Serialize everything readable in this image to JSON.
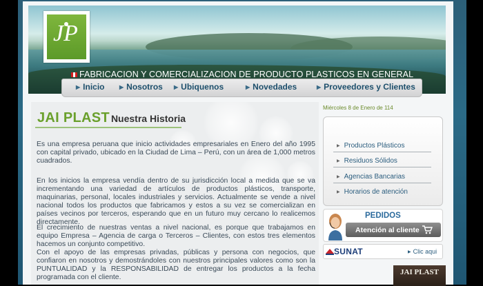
{
  "header": {
    "tagline": "FABRICACION Y COMERCIALIZACION DE PRODUCTO PLASTICOS EN GENERAL",
    "logo_text": "JP",
    "nav": [
      {
        "label": "Inicio"
      },
      {
        "label": "Nosotros"
      },
      {
        "label": "Ubiquenos"
      },
      {
        "label": "Novedades"
      },
      {
        "label": "Proveedores y Clientes"
      }
    ]
  },
  "main": {
    "brand": "JAI PLAST",
    "subtitle": "Nuestra Historia",
    "paragraphs": [
      "Es una empresa peruana que inicio  actividades  empresariales en Enero del año 1995 con capital  privado,  ubicado en la Ciudad de Lima – Perú, con un área de 1,000 metros cuadrados.",
      "En los inicios la empresa vendía dentro de su jurisdicción local a medida que se va incrementando una variedad de artículos de productos plásticos, transporte, maquinarias, personal, locales industriales y servicios. Actualmente se  vende a nivel nacional  todos los  productos que fabricamos y  estos a su vez se comercializan en países vecinos por terceros, esperando que en un  futuro muy  cercano lo realicemos directamente.",
      "El crecimiento de  nuestras ventas a nivel nacional, es porque que trabajamos en equipo Empresa – Agencia de carga o Terceros – Clientes, con estos tres elementos hacemos un conjunto competitivo.",
      "Con el apoyo de las empresas privadas, públicas y persona con negocios,  que confiaron en nosotros y  demostrándoles con  nuestros principales valores como son la PUNTUALIDAD y la RESPONSABILIDAD de entregar los productos a la fecha programada con el cliente."
    ]
  },
  "sidebar": {
    "date": "Miércoles 8 de Enero de 114",
    "links": [
      {
        "label": "Productos Plásticos"
      },
      {
        "label": "Residuos Sólidos"
      },
      {
        "label": "Agencias Bancarias"
      },
      {
        "label": "Horarios de atención"
      }
    ],
    "pedidos_title": "PEDIDOS",
    "pedidos_button": "Atención al cliente",
    "sunat_logo": "SUNAT",
    "sunat_link": "Clic aqui",
    "promo_text": "JAI PLAST"
  },
  "colors": {
    "accent_green": "#6aa02c",
    "nav_text": "#1d4f6c",
    "link_blue": "#2b5d7e"
  },
  "icons": {
    "nav_bullet": "triangle-right-icon",
    "side_arrow": "triangle-right-icon",
    "cart": "cart-icon",
    "flag": "peru-flag-icon"
  }
}
